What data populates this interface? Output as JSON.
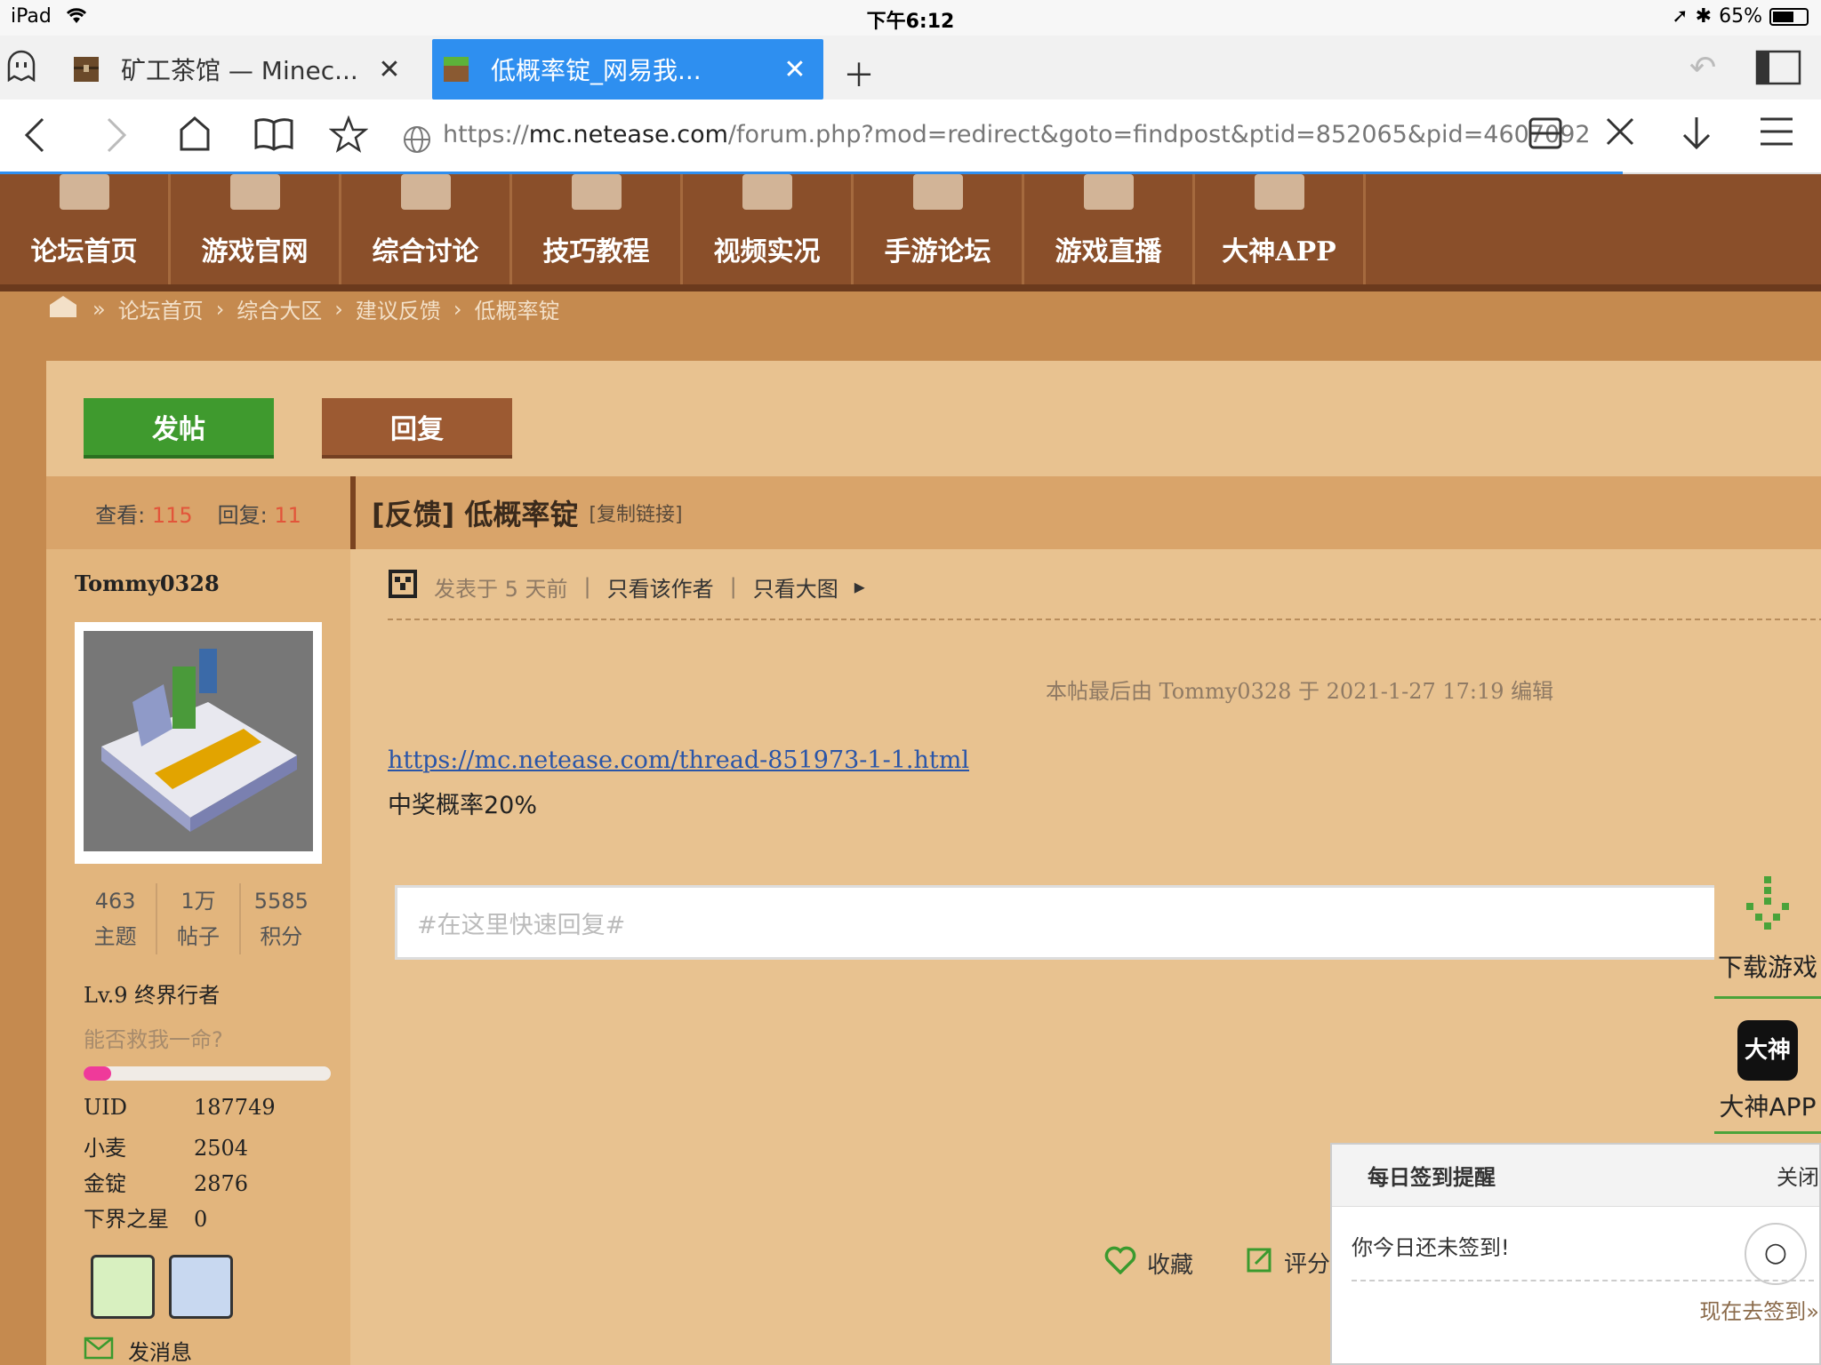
{
  "status": {
    "device": "iPad",
    "time": "下午6:12",
    "battery": "65%",
    "battery_level": 0.65
  },
  "tabs": [
    {
      "title": "矿工茶馆 — Minec...",
      "active": false
    },
    {
      "title": "低概率锭_网易我...",
      "active": true
    }
  ],
  "url": {
    "scheme": "https://",
    "host": "mc.netease.com",
    "path": "/forum.php?mod=redirect&goto=findpost&ptid=852065&pid=4607092"
  },
  "nav": [
    "论坛首页",
    "游戏官网",
    "综合讨论",
    "技巧教程",
    "视频实况",
    "手游论坛",
    "游戏直播",
    "大神APP"
  ],
  "breadcrumb": [
    "论坛首页",
    "综合大区",
    "建议反馈",
    "低概率锭"
  ],
  "buttons": {
    "post": "发帖",
    "reply": "回复"
  },
  "thread": {
    "views_label": "查看:",
    "views": "115",
    "replies_label": "回复:",
    "replies": "11",
    "title": "[反馈] 低概率锭",
    "copy_link": "[复制链接]",
    "posted": "发表于 5 天前",
    "only_author": "只看该作者",
    "only_images": "只看大图",
    "edited": "本帖最后由 Tommy0328 于 2021-1-27 17:19 编辑",
    "link": "https://mc.netease.com/thread-851973-1-1.html",
    "body": "中奖概率20%",
    "quick_reply_placeholder": "#在这里快速回复#",
    "favorite": "收藏",
    "rate": "评分"
  },
  "user": {
    "name": "Tommy0328",
    "stats": [
      {
        "value": "463",
        "label": "主题"
      },
      {
        "value": "1万",
        "label": "帖子"
      },
      {
        "value": "5585",
        "label": "积分"
      }
    ],
    "level": "Lv.9 终界行者",
    "motto": "能否救我一命?",
    "exp_progress": 0.11,
    "fields": [
      {
        "k": "UID",
        "v": "187749"
      },
      {
        "k": "小麦",
        "v": "2504"
      },
      {
        "k": "金锭",
        "v": "2876"
      },
      {
        "k": "下界之星",
        "v": "0"
      }
    ],
    "send_message": "发消息"
  },
  "floating": {
    "download": "下载游戏",
    "app": "大神APP"
  },
  "signin": {
    "title": "每日签到提醒",
    "close": "关闭",
    "message": "你今日还未签到!",
    "go": "现在去签到»"
  }
}
